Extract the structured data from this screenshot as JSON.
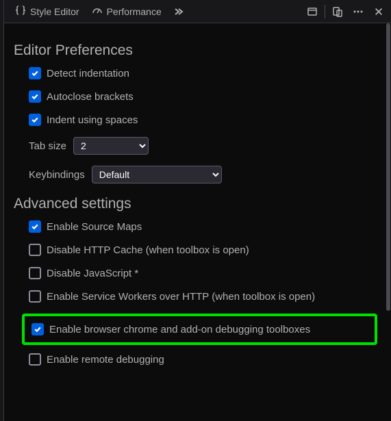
{
  "toolbar": {
    "tabs": [
      {
        "label": "Style Editor"
      },
      {
        "label": "Performance"
      }
    ]
  },
  "editor_prefs": {
    "title": "Editor Preferences",
    "detect_indent": {
      "label": "Detect indentation",
      "checked": true
    },
    "autoclose": {
      "label": "Autoclose brackets",
      "checked": true
    },
    "indent_spaces": {
      "label": "Indent using spaces",
      "checked": true
    },
    "tab_size": {
      "label": "Tab size",
      "value": "2"
    },
    "keybindings": {
      "label": "Keybindings",
      "value": "Default"
    }
  },
  "advanced": {
    "title": "Advanced settings",
    "source_maps": {
      "label": "Enable Source Maps",
      "checked": true
    },
    "disable_http_cache": {
      "label": "Disable HTTP Cache (when toolbox is open)",
      "checked": false
    },
    "disable_js": {
      "label": "Disable JavaScript *",
      "checked": false
    },
    "service_workers": {
      "label": "Enable Service Workers over HTTP (when toolbox is open)",
      "checked": false
    },
    "chrome_debug": {
      "label": "Enable browser chrome and add-on debugging toolboxes",
      "checked": true
    },
    "remote_debug": {
      "label": "Enable remote debugging",
      "checked": false
    }
  }
}
